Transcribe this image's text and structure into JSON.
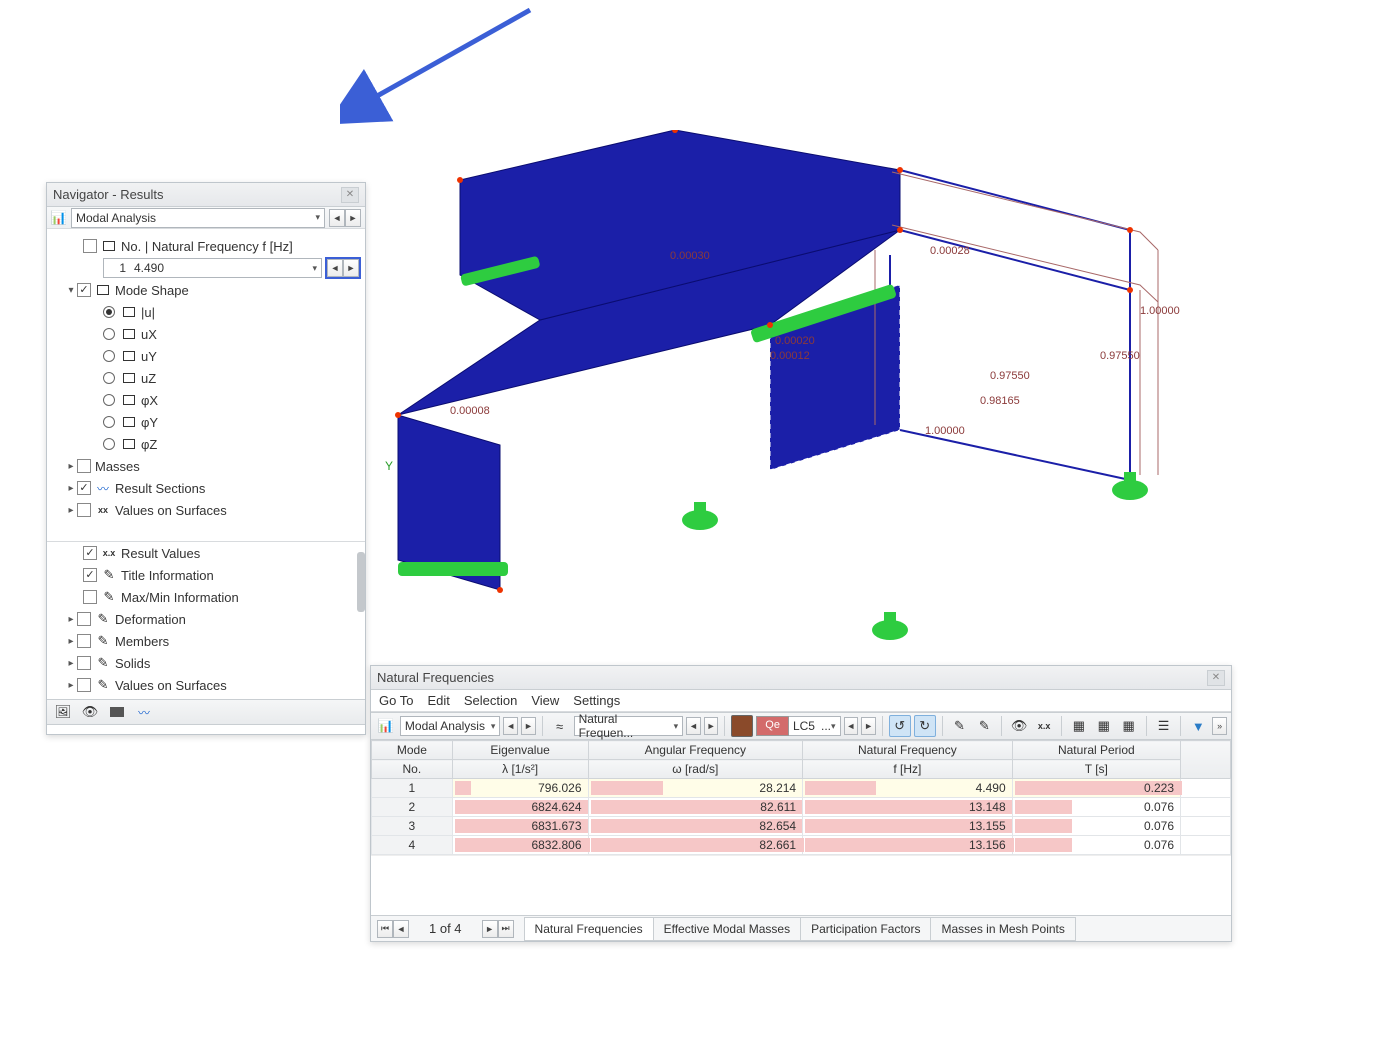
{
  "navigator": {
    "title": "Navigator - Results",
    "analysis": "Modal Analysis",
    "freq_label": "No. | Natural Frequency f [Hz]",
    "mode_no": "1",
    "mode_freq": "4.490",
    "tree": {
      "mode_shape": "Mode Shape",
      "u_abs": "|u|",
      "ux": "uX",
      "uy": "uY",
      "uz": "uZ",
      "phix": "φX",
      "phiy": "φY",
      "phiz": "φZ",
      "masses": "Masses",
      "result_sections": "Result Sections",
      "vals_surf": "Values on Surfaces",
      "result_values": "Result Values",
      "title_info": "Title Information",
      "maxmin": "Max/Min Information",
      "deformation": "Deformation",
      "members": "Members",
      "solids": "Solids",
      "vals_surf2": "Values on Surfaces"
    }
  },
  "viewport": {
    "labels": [
      "0.00030",
      "0.00028",
      "1.00000",
      "0.97550",
      "0.97550",
      "0.98165",
      "1.00000",
      "0.00020",
      "0.00012",
      "0.00008"
    ]
  },
  "table_panel": {
    "title": "Natural Frequencies",
    "menu": [
      "Go To",
      "Edit",
      "Selection",
      "View",
      "Settings"
    ],
    "combo1": "Modal Analysis",
    "combo2": "Natural Frequen...",
    "qe": "Qe",
    "lc": "LC5",
    "dots": "...",
    "headers": {
      "mode": "Mode",
      "no": "No.",
      "eigen_top": "Eigenvalue",
      "eigen_bot": "λ [1/s²]",
      "ang_top": "Angular Frequency",
      "ang_bot": "ω [rad/s]",
      "nat_top": "Natural Frequency",
      "nat_bot": "f [Hz]",
      "per_top": "Natural Period",
      "per_bot": "T [s]"
    },
    "rows": [
      {
        "no": "1",
        "eigen": "796.026",
        "ang": "28.214",
        "nat": "4.490",
        "per": "0.223",
        "pct_e": 12,
        "pct_a": 34,
        "pct_n": 34,
        "pct_p": 100,
        "sel": true
      },
      {
        "no": "2",
        "eigen": "6824.624",
        "ang": "82.611",
        "nat": "13.148",
        "per": "0.076",
        "pct_e": 99,
        "pct_a": 99,
        "pct_n": 99,
        "pct_p": 34
      },
      {
        "no": "3",
        "eigen": "6831.673",
        "ang": "82.654",
        "nat": "13.155",
        "per": "0.076",
        "pct_e": 99,
        "pct_a": 99,
        "pct_n": 99,
        "pct_p": 34
      },
      {
        "no": "4",
        "eigen": "6832.806",
        "ang": "82.661",
        "nat": "13.156",
        "per": "0.076",
        "pct_e": 100,
        "pct_a": 100,
        "pct_n": 100,
        "pct_p": 34
      }
    ],
    "paging": "1 of 4",
    "tabs": [
      "Natural Frequencies",
      "Effective Modal Masses",
      "Participation Factors",
      "Masses in Mesh Points"
    ]
  }
}
